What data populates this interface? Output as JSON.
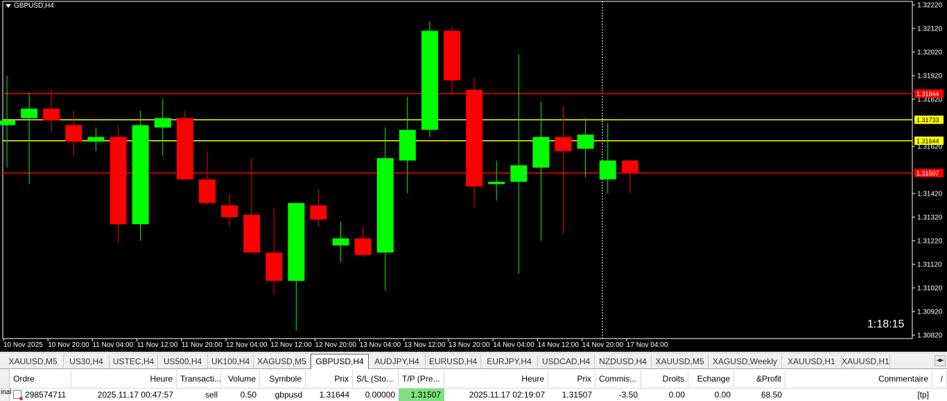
{
  "chart": {
    "symbol_label": "GBPUSD,H4",
    "countdown": "1:18:15",
    "colors": {
      "bull": "#00ff00",
      "bear": "#ff0000",
      "background": "#000000",
      "grid_text": "#ffffff",
      "red_line": "#ff0000",
      "yellow_line": "#ffff00"
    },
    "price_ticks": [
      "1.32220",
      "1.32120",
      "1.32020",
      "1.31920",
      "1.31820",
      "1.31620",
      "1.31420",
      "1.31320",
      "1.31220",
      "1.31120",
      "1.31020",
      "1.30920",
      "1.30820"
    ],
    "time_ticks": [
      "10 Nov 2025",
      "10 Nov 20:00",
      "11 Nov 04:00",
      "11 Nov 12:00",
      "11 Nov 20:00",
      "12 Nov 04:00",
      "12 Nov 12:00",
      "12 Nov 20:00",
      "13 Nov 04:00",
      "13 Nov 12:00",
      "13 Nov 20:00",
      "14 Nov 04:00",
      "14 Nov 12:00",
      "14 Nov 20:00",
      "17 Nov 04:00"
    ],
    "levels": [
      {
        "price": 1.31844,
        "label": "1.31844",
        "color": "#ff0000"
      },
      {
        "price": 1.31733,
        "label": "1.31733",
        "color": "#ffff00"
      },
      {
        "price": 1.31644,
        "label": "1.31644",
        "color": "#ffff00"
      },
      {
        "price": 1.31507,
        "label": "1.31507",
        "color": "#ff0000"
      }
    ]
  },
  "chart_data": {
    "type": "candlestick",
    "title": "GBPUSD,H4",
    "ylim": [
      1.3078,
      1.3226
    ],
    "candles": [
      {
        "t": "10 Nov 2025",
        "o": 1.3171,
        "h": 1.3192,
        "l": 1.3153,
        "c": 1.3173
      },
      {
        "t": "10 Nov 04:00",
        "o": 1.3174,
        "h": 1.3185,
        "l": 1.3146,
        "c": 1.3178
      },
      {
        "t": "10 Nov 08:00",
        "o": 1.3178,
        "h": 1.3186,
        "l": 1.3168,
        "c": 1.3173
      },
      {
        "t": "10 Nov 12:00",
        "o": 1.3171,
        "h": 1.3177,
        "l": 1.3158,
        "c": 1.3164
      },
      {
        "t": "10 Nov 16:00",
        "o": 1.3164,
        "h": 1.317,
        "l": 1.316,
        "c": 1.3166
      },
      {
        "t": "10 Nov 20:00",
        "o": 1.3166,
        "h": 1.3171,
        "l": 1.3121,
        "c": 1.3129
      },
      {
        "t": "11 Nov 00:00",
        "o": 1.3129,
        "h": 1.3177,
        "l": 1.3122,
        "c": 1.3171
      },
      {
        "t": "11 Nov 04:00",
        "o": 1.317,
        "h": 1.3182,
        "l": 1.3158,
        "c": 1.3174
      },
      {
        "t": "11 Nov 08:00",
        "o": 1.3174,
        "h": 1.3177,
        "l": 1.3148,
        "c": 1.3148
      },
      {
        "t": "11 Nov 12:00",
        "o": 1.3148,
        "h": 1.316,
        "l": 1.3137,
        "c": 1.3138
      },
      {
        "t": "11 Nov 16:00",
        "o": 1.3137,
        "h": 1.3142,
        "l": 1.3128,
        "c": 1.3132
      },
      {
        "t": "11 Nov 20:00",
        "o": 1.3133,
        "h": 1.3157,
        "l": 1.3117,
        "c": 1.3117
      },
      {
        "t": "12 Nov 00:00",
        "o": 1.3117,
        "h": 1.3136,
        "l": 1.3099,
        "c": 1.3105
      },
      {
        "t": "12 Nov 04:00",
        "o": 1.3105,
        "h": 1.3138,
        "l": 1.3084,
        "c": 1.3138
      },
      {
        "t": "12 Nov 08:00",
        "o": 1.3137,
        "h": 1.3144,
        "l": 1.3128,
        "c": 1.3131
      },
      {
        "t": "12 Nov 12:00",
        "o": 1.312,
        "h": 1.313,
        "l": 1.3113,
        "c": 1.3123
      },
      {
        "t": "12 Nov 16:00",
        "o": 1.3123,
        "h": 1.3128,
        "l": 1.3115,
        "c": 1.3116
      },
      {
        "t": "12 Nov 20:00",
        "o": 1.3117,
        "h": 1.317,
        "l": 1.3101,
        "c": 1.3157
      },
      {
        "t": "13 Nov 00:00",
        "o": 1.3156,
        "h": 1.3183,
        "l": 1.3142,
        "c": 1.3169
      },
      {
        "t": "13 Nov 04:00",
        "o": 1.3169,
        "h": 1.3215,
        "l": 1.3166,
        "c": 1.3211
      },
      {
        "t": "13 Nov 08:00",
        "o": 1.3211,
        "h": 1.3213,
        "l": 1.3184,
        "c": 1.319
      },
      {
        "t": "13 Nov 12:00",
        "o": 1.3186,
        "h": 1.3191,
        "l": 1.3136,
        "c": 1.3145
      },
      {
        "t": "13 Nov 16:00",
        "o": 1.3146,
        "h": 1.3156,
        "l": 1.3139,
        "c": 1.3147
      },
      {
        "t": "13 Nov 20:00",
        "o": 1.3147,
        "h": 1.3201,
        "l": 1.3108,
        "c": 1.3154
      },
      {
        "t": "14 Nov 00:00",
        "o": 1.3153,
        "h": 1.3181,
        "l": 1.3122,
        "c": 1.3166
      },
      {
        "t": "14 Nov 04:00",
        "o": 1.3166,
        "h": 1.3179,
        "l": 1.3125,
        "c": 1.316
      },
      {
        "t": "14 Nov 08:00",
        "o": 1.3161,
        "h": 1.3174,
        "l": 1.3149,
        "c": 1.3167
      },
      {
        "t": "14 Nov 12:00",
        "o": 1.3148,
        "h": 1.3172,
        "l": 1.3142,
        "c": 1.3156
      },
      {
        "t": "14 Nov 16:00",
        "o": 1.3156,
        "h": 1.3156,
        "l": 1.3142,
        "c": 1.3151
      }
    ]
  },
  "tabs": [
    {
      "label": "XAUUSD,M5",
      "active": false
    },
    {
      "label": "US30,H4",
      "active": false
    },
    {
      "label": "USTEC,H4",
      "active": false
    },
    {
      "label": "US500,H4",
      "active": false
    },
    {
      "label": "UK100,H4",
      "active": false
    },
    {
      "label": "XAGUSD,M5",
      "active": false
    },
    {
      "label": "GBPUSD,H4",
      "active": true
    },
    {
      "label": "AUDJPY,H4",
      "active": false
    },
    {
      "label": "EURUSD,H4",
      "active": false
    },
    {
      "label": "EURJPY,H4",
      "active": false
    },
    {
      "label": "USDCAD,H4",
      "active": false
    },
    {
      "label": "NZDUSD,H4",
      "active": false
    },
    {
      "label": "XAUUSD,M5",
      "active": false
    },
    {
      "label": "XAGUSD,Weekly",
      "active": false
    },
    {
      "label": "XAUUSD,H1",
      "active": false
    },
    {
      "label": "XAUUSD,H1",
      "active": false
    }
  ],
  "tab_scroll_label": "◂▸",
  "terminal": {
    "side_label": "inal",
    "headers": [
      "Ordre",
      "Heure",
      "Transacti...",
      "Volume",
      "Symbole",
      "Prix",
      "S/L (Sto...",
      "T/P (Pre...",
      "Heure",
      "Prix",
      "Commis...",
      "Droits",
      "Echange",
      "&Profit",
      "Commentaire",
      "/"
    ],
    "row": {
      "ordre": "298574711",
      "heure_open": "2025.11.17 00:47:57",
      "type": "sell",
      "volume": "0.50",
      "symbole": "gbpusd",
      "prix": "1.31644",
      "sl": "0.00000",
      "tp": "1.31507",
      "heure_close": "2025.11.17 02:19:07",
      "prix_close": "1.31507",
      "commission": "-3.50",
      "droits": "0.00",
      "echange": "0.00",
      "profit": "68.50",
      "commentaire": "[tp]"
    }
  }
}
